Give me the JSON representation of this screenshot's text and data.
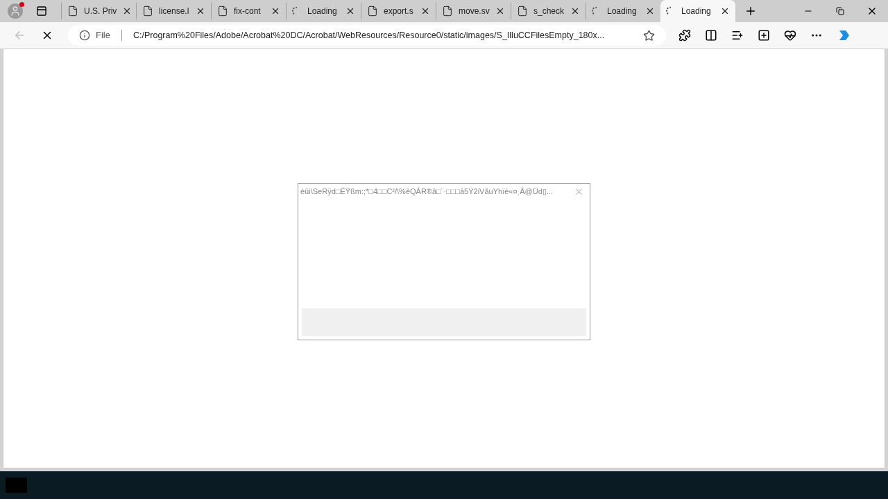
{
  "tabs": [
    {
      "kind": "file",
      "label": "U.S. Priv",
      "selected": false
    },
    {
      "kind": "file",
      "label": "license.l",
      "selected": false
    },
    {
      "kind": "file",
      "label": "fix-cont",
      "selected": false
    },
    {
      "kind": "loading",
      "label": "Loading",
      "selected": false
    },
    {
      "kind": "file",
      "label": "export.s",
      "selected": false
    },
    {
      "kind": "file",
      "label": "move.sv",
      "selected": false
    },
    {
      "kind": "file",
      "label": "s_check",
      "selected": false
    },
    {
      "kind": "loading",
      "label": "Loading",
      "selected": false
    },
    {
      "kind": "loading",
      "label": "Loading",
      "selected": true
    }
  ],
  "address_bar": {
    "scheme": "File",
    "url": "C:/Program%20Files/Adobe/Acrobat%20DC/Acrobat/WebResources/Resource0/static/images/S_IlluCCFilesEmpty_180x..."
  },
  "dialog": {
    "title": "èûi\\SeRÿd□ÉŸßm:;*□4□□C²/\\%êQÂR®â□¨·□□□â5Ý2iVåuYhïè«¤ͺÂ@Üd▯..."
  }
}
